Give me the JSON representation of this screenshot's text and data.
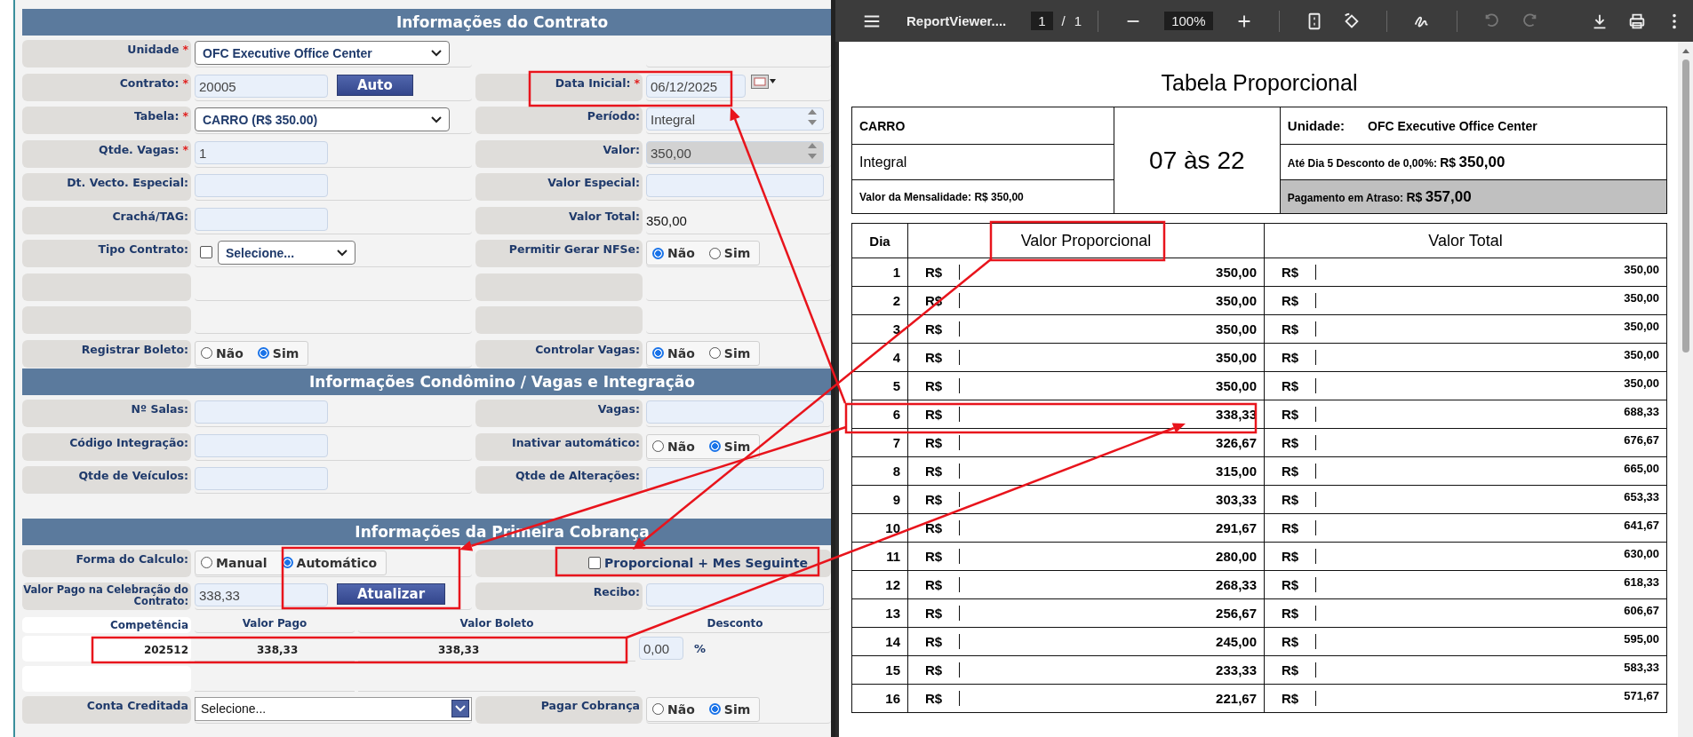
{
  "form": {
    "sections": [
      {
        "title": "Informações do Contrato",
        "rows": [
          {
            "kind": "pair",
            "left": {
              "label": "Unidade",
              "mark": "*",
              "field": {
                "kind": "select",
                "value": "OFC Executive Office Center"
              }
            }
          },
          {
            "kind": "pair",
            "left": {
              "label": "Contrato:",
              "mark": "*",
              "field": {
                "kind": "input-button",
                "value": "20005",
                "button": "Auto"
              }
            },
            "right": {
              "label": "Data Inicial:",
              "mark": "*",
              "field": {
                "kind": "date",
                "value": "06/12/2025"
              }
            }
          },
          {
            "kind": "pair",
            "left": {
              "label": "Tabela:",
              "mark": "*",
              "field": {
                "kind": "select",
                "value": "CARRO (R$ 350.00)"
              }
            },
            "right": {
              "label": "Período:",
              "field": {
                "kind": "spinner",
                "value": "Integral",
                "readonly": false
              }
            }
          },
          {
            "kind": "pair",
            "left": {
              "label": "Qtde. Vagas:",
              "mark": "*",
              "field": {
                "kind": "input",
                "value": "1"
              }
            },
            "right": {
              "label": "Valor:",
              "field": {
                "kind": "spinner",
                "value": "350,00",
                "readonly": true
              }
            }
          },
          {
            "kind": "pair",
            "left": {
              "label": "Dt. Vecto. Especial:",
              "field": {
                "kind": "input"
              }
            },
            "right": {
              "label": "Valor Especial:",
              "field": {
                "kind": "input"
              }
            }
          },
          {
            "kind": "pair",
            "left": {
              "label": "Crachá/TAG:",
              "field": {
                "kind": "input"
              }
            },
            "right": {
              "label": "Valor Total:",
              "field": {
                "kind": "text",
                "value": "350,00"
              }
            }
          },
          {
            "kind": "pair",
            "left": {
              "label": "Tipo Contrato:",
              "field": {
                "kind": "check-select",
                "checked": false,
                "value": "Selecione..."
              }
            },
            "right": {
              "label": "Permitir Gerar NFSe:",
              "field": {
                "kind": "radio",
                "options": [
                  {
                    "label": "Não",
                    "selected": true
                  },
                  {
                    "label": "Sim",
                    "selected": false
                  }
                ]
              }
            }
          },
          {
            "kind": "pair",
            "left": {
              "field": {
                "kind": "none"
              }
            },
            "right": {
              "field": {
                "kind": "none"
              }
            }
          },
          {
            "kind": "pair",
            "left": {
              "field": {
                "kind": "none"
              }
            },
            "right": {
              "field": {
                "kind": "none"
              }
            }
          },
          {
            "kind": "pair",
            "left": {
              "label": "Registrar Boleto:",
              "field": {
                "kind": "radio",
                "options": [
                  {
                    "label": "Não",
                    "selected": false
                  },
                  {
                    "label": "Sim",
                    "selected": true
                  }
                ]
              }
            },
            "right": {
              "label": "Controlar Vagas:",
              "field": {
                "kind": "radio",
                "options": [
                  {
                    "label": "Não",
                    "selected": true
                  },
                  {
                    "label": "Sim",
                    "selected": false
                  }
                ]
              }
            }
          }
        ]
      },
      {
        "title": "Informações Condômino / Vagas e Integração",
        "rows": [
          {
            "kind": "pair",
            "left": {
              "label": "Nº Salas:",
              "field": {
                "kind": "input"
              }
            },
            "right": {
              "label": "Vagas:",
              "field": {
                "kind": "input"
              }
            }
          },
          {
            "kind": "pair",
            "left": {
              "label": "Código Integração:",
              "field": {
                "kind": "input"
              }
            },
            "right": {
              "label": "Inativar automático:",
              "field": {
                "kind": "radio",
                "options": [
                  {
                    "label": "Não",
                    "selected": false
                  },
                  {
                    "label": "Sim",
                    "selected": true
                  }
                ]
              }
            }
          },
          {
            "kind": "pair",
            "left": {
              "label": "Qtde de Veículos:",
              "field": {
                "kind": "input"
              }
            },
            "right": {
              "label": "Qtde de Alterações:",
              "field": {
                "kind": "input"
              }
            }
          },
          {
            "kind": "gap"
          }
        ]
      },
      {
        "title": "Informações da Primeira Cobrança",
        "rows": [
          {
            "kind": "pair",
            "left": {
              "label": "Forma do Calculo:",
              "field": {
                "kind": "radio",
                "options": [
                  {
                    "label": "Manual",
                    "selected": false
                  },
                  {
                    "label": "Automático",
                    "selected": true
                  }
                ]
              }
            },
            "right": {
              "field": {
                "kind": "checkbox",
                "checked": false,
                "label": "Proporcional + Mes Seguinte"
              }
            }
          },
          {
            "kind": "pair",
            "left": {
              "label": "Valor Pago na Celebração do Contrato:",
              "field": {
                "kind": "input-button",
                "value": "338,33",
                "button": "Atualizar"
              }
            },
            "right": {
              "label": "Recibo:",
              "field": {
                "kind": "input"
              }
            }
          },
          {
            "kind": "billing-head",
            "cells": [
              "Competência",
              "Valor Pago",
              "Valor Boleto",
              "Desconto"
            ]
          },
          {
            "kind": "billing-row",
            "cells": [
              "202512",
              "338,33",
              "338,33"
            ],
            "discount": "0,00",
            "unit": "%"
          },
          {
            "kind": "billing-row",
            "cells": []
          },
          {
            "kind": "pair",
            "left": {
              "label": "Conta Creditada",
              "field": {
                "kind": "combo",
                "value": "Selecione..."
              }
            },
            "right": {
              "label": "Pagar Cobrança",
              "field": {
                "kind": "radio",
                "options": [
                  {
                    "label": "Não",
                    "selected": false
                  },
                  {
                    "label": "Sim",
                    "selected": true
                  }
                ]
              }
            }
          }
        ]
      }
    ]
  },
  "viewer": {
    "toolbar": {
      "title": "ReportViewer....",
      "page": "1",
      "separator": "/",
      "pages": "1",
      "zoom": "100%",
      "undo_disabled": true,
      "redo_disabled": true
    },
    "report": {
      "title": "Tabela Proporcional",
      "vehicle": "CARRO",
      "period": "Integral",
      "monthly": "Valor da Mensalidade: R$ 350,00",
      "hours": "07 às 22",
      "unit": {
        "label": "Unidade:",
        "value": "OFC Executive Office Center"
      },
      "discount": {
        "label": "Até Dia 5 Desconto de 0,00%:",
        "currency": "R$",
        "value": "350,00"
      },
      "late": {
        "label": "Pagamento em Atraso:",
        "currency": "R$",
        "value": "357,00"
      },
      "columns": [
        "Dia",
        "Valor Proporcional",
        "Valor Total"
      ],
      "rows": [
        {
          "day": "1",
          "proportional": {
            "currency": "R$",
            "value": "350,00"
          },
          "total": {
            "currency": "R$",
            "value": "350,00"
          }
        },
        {
          "day": "2",
          "proportional": {
            "currency": "R$",
            "value": "350,00"
          },
          "total": {
            "currency": "R$",
            "value": "350,00"
          }
        },
        {
          "day": "3",
          "proportional": {
            "currency": "R$",
            "value": "350,00"
          },
          "total": {
            "currency": "R$",
            "value": "350,00"
          }
        },
        {
          "day": "4",
          "proportional": {
            "currency": "R$",
            "value": "350,00"
          },
          "total": {
            "currency": "R$",
            "value": "350,00"
          }
        },
        {
          "day": "5",
          "proportional": {
            "currency": "R$",
            "value": "350,00"
          },
          "total": {
            "currency": "R$",
            "value": "350,00"
          }
        },
        {
          "day": "6",
          "proportional": {
            "currency": "R$",
            "value": "338,33"
          },
          "total": {
            "currency": "R$",
            "value": "688,33"
          }
        },
        {
          "day": "7",
          "proportional": {
            "currency": "R$",
            "value": "326,67"
          },
          "total": {
            "currency": "R$",
            "value": "676,67"
          }
        },
        {
          "day": "8",
          "proportional": {
            "currency": "R$",
            "value": "315,00"
          },
          "total": {
            "currency": "R$",
            "value": "665,00"
          }
        },
        {
          "day": "9",
          "proportional": {
            "currency": "R$",
            "value": "303,33"
          },
          "total": {
            "currency": "R$",
            "value": "653,33"
          }
        },
        {
          "day": "10",
          "proportional": {
            "currency": "R$",
            "value": "291,67"
          },
          "total": {
            "currency": "R$",
            "value": "641,67"
          }
        },
        {
          "day": "11",
          "proportional": {
            "currency": "R$",
            "value": "280,00"
          },
          "total": {
            "currency": "R$",
            "value": "630,00"
          }
        },
        {
          "day": "12",
          "proportional": {
            "currency": "R$",
            "value": "268,33"
          },
          "total": {
            "currency": "R$",
            "value": "618,33"
          }
        },
        {
          "day": "13",
          "proportional": {
            "currency": "R$",
            "value": "256,67"
          },
          "total": {
            "currency": "R$",
            "value": "606,67"
          }
        },
        {
          "day": "14",
          "proportional": {
            "currency": "R$",
            "value": "245,00"
          },
          "total": {
            "currency": "R$",
            "value": "595,00"
          }
        },
        {
          "day": "15",
          "proportional": {
            "currency": "R$",
            "value": "233,33"
          },
          "total": {
            "currency": "R$",
            "value": "583,33"
          }
        },
        {
          "day": "16",
          "proportional": {
            "currency": "R$",
            "value": "221,67"
          },
          "total": {
            "currency": "R$",
            "value": "571,67"
          }
        }
      ]
    }
  }
}
